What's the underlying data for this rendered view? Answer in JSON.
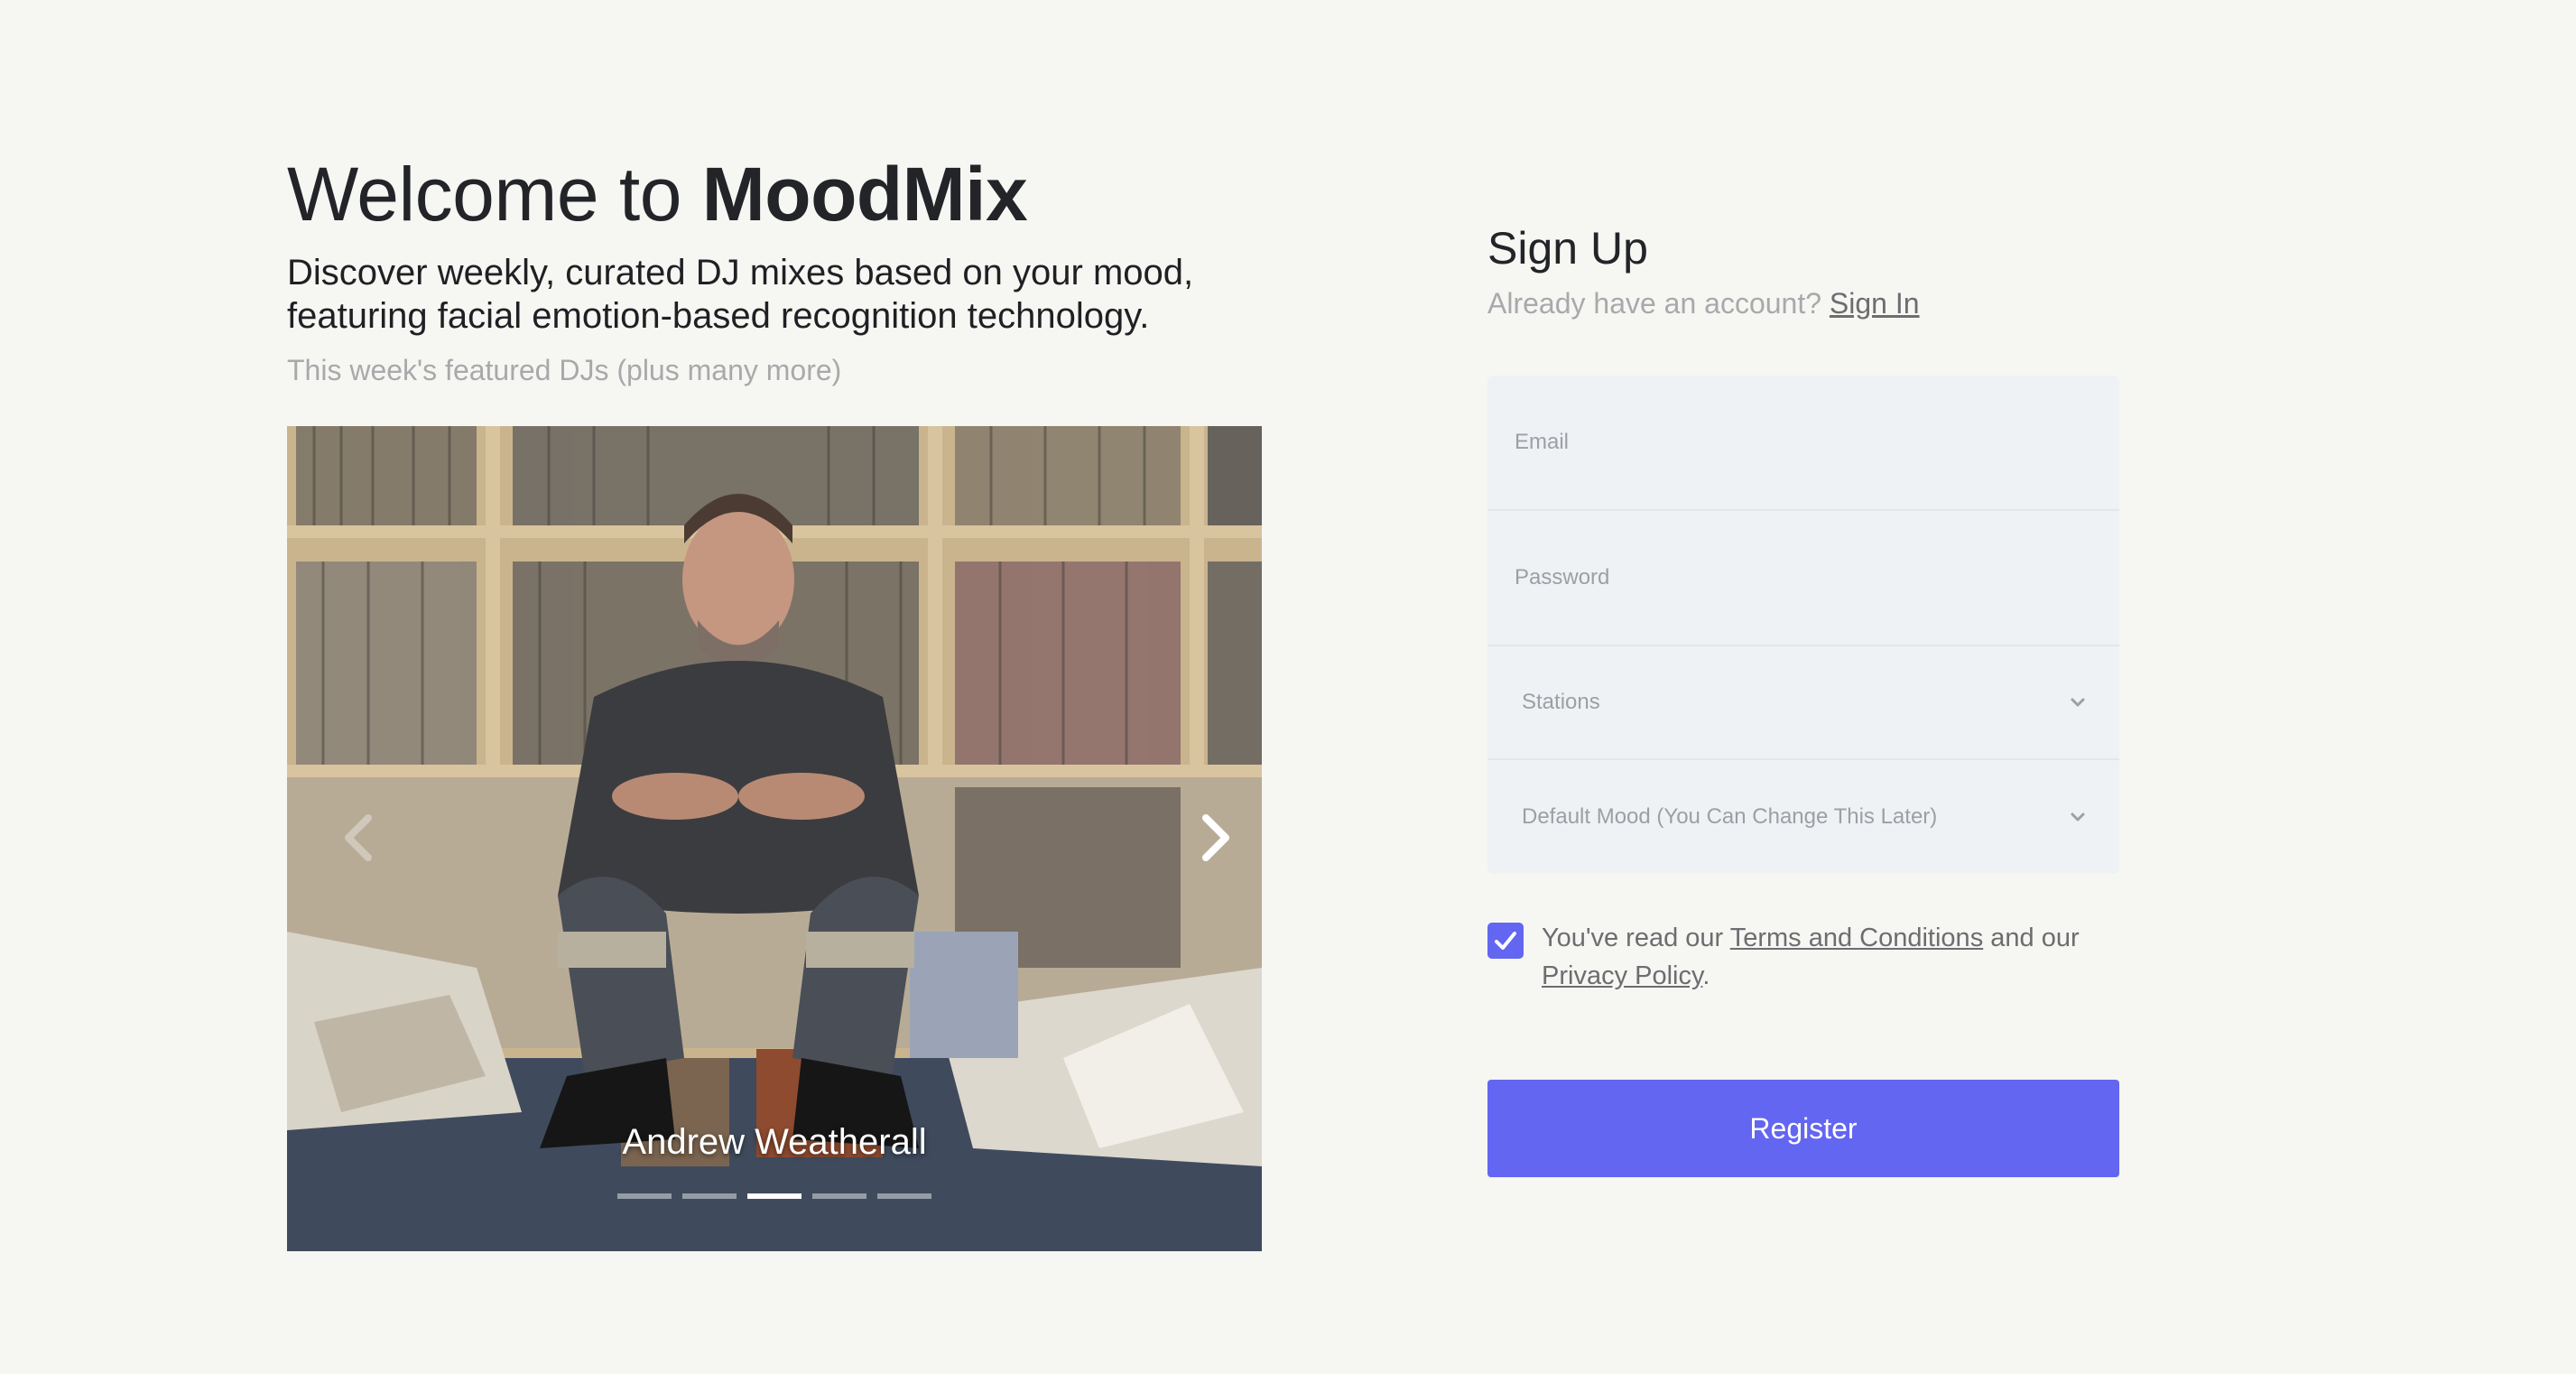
{
  "hero": {
    "welcome_prefix": "Welcome to ",
    "brand": "MoodMix",
    "tagline": "Discover weekly, curated DJ mixes based on your mood, featuring facial emotion-based recognition technology.",
    "featured_note": "This week's featured DJs (plus many more)"
  },
  "carousel": {
    "current_caption": "Andrew Weatherall",
    "slide_count": 5,
    "active_index": 2,
    "prev_icon": "chevron-left-icon",
    "next_icon": "chevron-right-icon"
  },
  "signup": {
    "title": "Sign Up",
    "have_account": "Already have an account?",
    "sign_in_link": "Sign In",
    "email_placeholder": "Email",
    "password_placeholder": "Password",
    "stations_label": "Stations",
    "mood_label": "Default Mood (You Can Change This Later)",
    "terms_checked": true,
    "consent_prefix": "You've read our ",
    "terms_link": "Terms and Conditions",
    "consent_middle": " and our ",
    "privacy_link": "Privacy Policy",
    "consent_suffix": ".",
    "register_label": "Register"
  },
  "colors": {
    "accent": "#6366f1",
    "background": "#f6f6f3",
    "form_background": "#eff2f4"
  }
}
